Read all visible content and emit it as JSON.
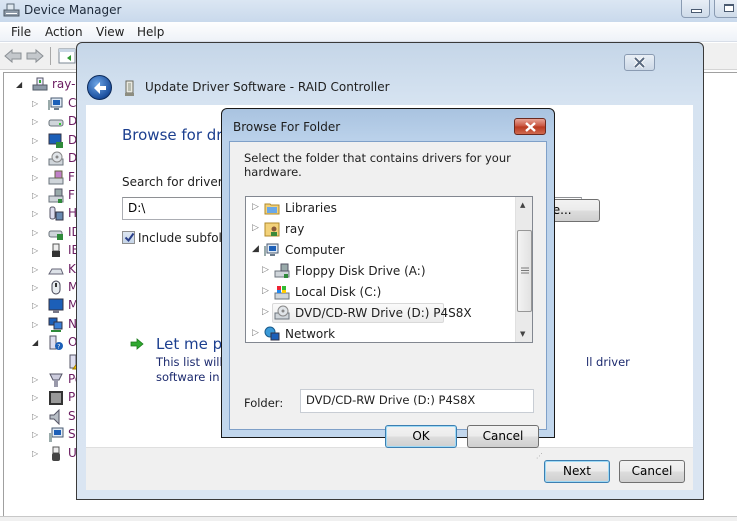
{
  "device_manager": {
    "title": "Device Manager",
    "menu": [
      "File",
      "Action",
      "View",
      "Help"
    ],
    "toolbar": {
      "back_icon": "back-arrow-icon",
      "forward_icon": "forward-arrow-icon",
      "console_icon": "show-hide-console-tree-icon"
    },
    "tree": {
      "root": {
        "label": "ray-P",
        "icon": "computer-icon",
        "expanded": true
      },
      "items": [
        {
          "label": "Co",
          "icon": "computer-icon"
        },
        {
          "label": "Di",
          "icon": "disk-drive-icon"
        },
        {
          "label": "Di",
          "icon": "display-adapter-icon"
        },
        {
          "label": "DV",
          "icon": "dvd-drive-icon"
        },
        {
          "label": "Fl",
          "icon": "floppy-controller-icon"
        },
        {
          "label": "Fl",
          "icon": "floppy-drive-icon"
        },
        {
          "label": "Hu",
          "icon": "human-interface-device-icon"
        },
        {
          "label": "ID",
          "icon": "ide-controller-icon"
        },
        {
          "label": "IEI",
          "icon": "ieee1394-icon"
        },
        {
          "label": "Ke",
          "icon": "keyboard-icon"
        },
        {
          "label": "M",
          "icon": "mouse-icon"
        },
        {
          "label": "M",
          "icon": "monitor-icon"
        },
        {
          "label": "N",
          "icon": "network-adapter-icon"
        },
        {
          "label": "Ot",
          "icon": "other-devices-icon",
          "expanded": true
        },
        {
          "label": "",
          "icon": "unknown-device-warning-icon",
          "child": true
        },
        {
          "label": "Po",
          "icon": "ports-icon"
        },
        {
          "label": "Pr",
          "icon": "processor-icon"
        },
        {
          "label": "So",
          "icon": "sound-icon"
        },
        {
          "label": "Sy",
          "icon": "system-devices-icon"
        },
        {
          "label": "Ur",
          "icon": "usb-controller-icon"
        }
      ]
    }
  },
  "wizard": {
    "title": "Update Driver Software - RAID Controller",
    "heading": "Browse for dri",
    "search_label": "Search for driver so",
    "path_value": "D:\\",
    "browse_label": "Browse...",
    "browse_visible_label": "vse...",
    "include_subfolders_label": "Include subfold",
    "include_subfolders_checked": true,
    "pick_title": "Let me pi",
    "pick_desc_line1": "This list will s",
    "pick_desc_line2": "software in t",
    "pick_desc_tail": "ll driver",
    "next_label": "Next",
    "cancel_label": "Cancel"
  },
  "browse_for_folder": {
    "title": "Browse For Folder",
    "description": "Select the folder that contains drivers for your hardware.",
    "tree": [
      {
        "label": "Libraries",
        "icon": "libraries-icon",
        "level": 0,
        "expanded": false
      },
      {
        "label": "ray",
        "icon": "user-folder-icon",
        "level": 0,
        "expanded": false
      },
      {
        "label": "Computer",
        "icon": "computer-icon",
        "level": 0,
        "expanded": true
      },
      {
        "label": "Floppy Disk Drive (A:)",
        "icon": "floppy-drive-icon",
        "level": 1,
        "expanded": false
      },
      {
        "label": "Local Disk (C:)",
        "icon": "local-disk-icon",
        "level": 1,
        "expanded": false
      },
      {
        "label": "DVD/CD-RW Drive (D:) P4S8X",
        "icon": "dvd-drive-icon",
        "level": 1,
        "expanded": false,
        "selected": true
      },
      {
        "label": "Network",
        "icon": "network-icon",
        "level": 0,
        "expanded": false
      }
    ],
    "folder_label": "Folder:",
    "folder_value": "DVD/CD-RW Drive (D:) P4S8X",
    "ok_label": "OK",
    "cancel_label": "Cancel"
  }
}
